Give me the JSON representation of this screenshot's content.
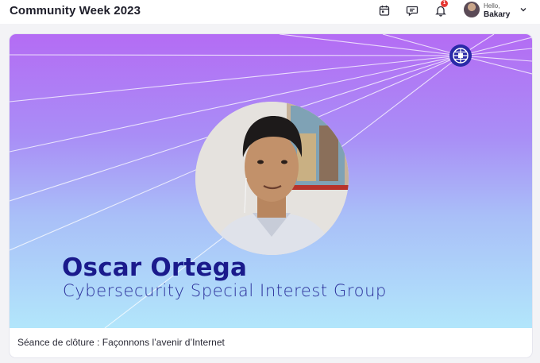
{
  "header": {
    "title": "Community Week 2023",
    "icons": [
      "calendar-icon",
      "chat-icon",
      "bell-icon"
    ],
    "notification_count": "1",
    "greeting": "Hello,",
    "user_name": "Bakary"
  },
  "session": {
    "speaker_name": "Oscar Ortega",
    "speaker_role": "Cybersecurity Special Interest Group",
    "title": "Séance de clôture : Façonnons l’avenir d’Internet"
  },
  "colors": {
    "gradient_top": "#b46cf4",
    "gradient_bottom": "#b2e6fb",
    "name_color": "#1a1a8c",
    "badge": "#e53935",
    "logo": "#2a2aa8"
  }
}
